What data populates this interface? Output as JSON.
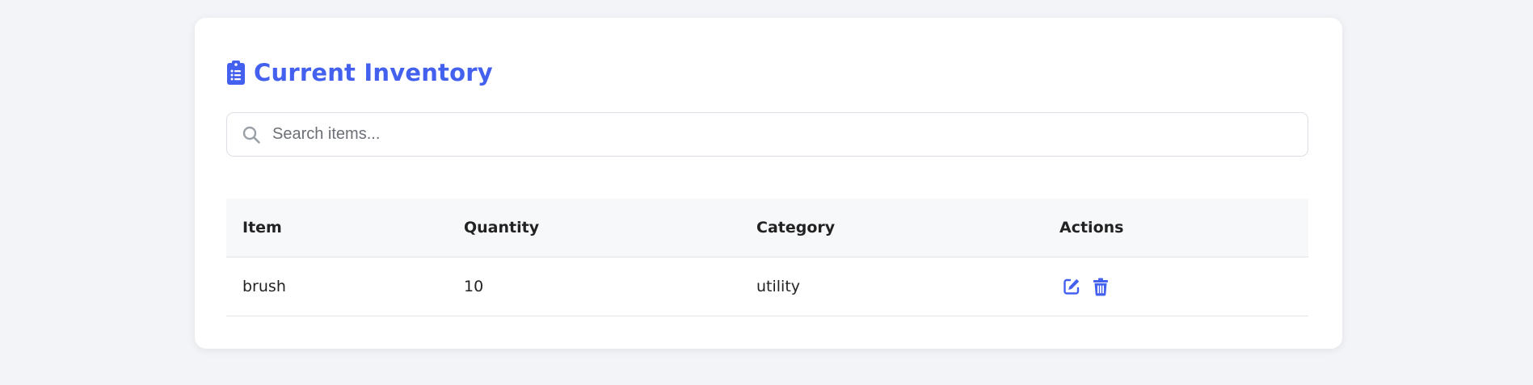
{
  "page": {
    "title": "Current Inventory",
    "title_icon": "clipboard-list-icon",
    "accent_color": "#4361ee"
  },
  "search": {
    "placeholder": "Search items...",
    "value": "",
    "icon": "search-icon"
  },
  "table": {
    "headers": [
      "Item",
      "Quantity",
      "Category",
      "Actions"
    ],
    "rows": [
      {
        "item": "brush",
        "quantity": "10",
        "category": "utility",
        "actions": [
          "edit-icon",
          "trash-icon"
        ]
      }
    ]
  }
}
